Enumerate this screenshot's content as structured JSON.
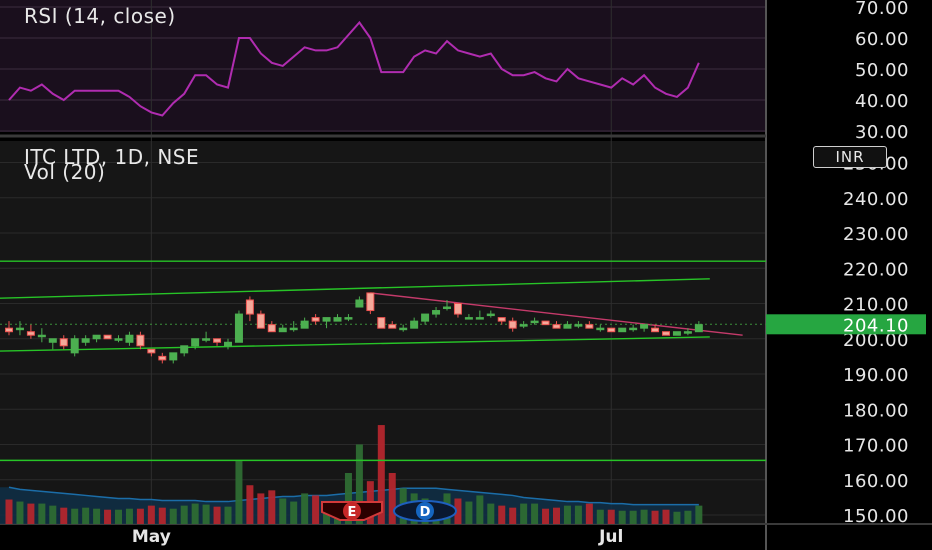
{
  "header": {
    "rsi_title": "RSI (14, close)",
    "instrument": "ITC LTD, 1D, NSE",
    "volume_label": "Vol (20)",
    "currency": "INR"
  },
  "colors": {
    "up": "#4caf50",
    "down": "#ef5350",
    "rsi_line": "#b02cb0",
    "trend_support": "#27c427",
    "trend_resistance": "#c43a6a",
    "price_badge": "#26a641",
    "volume_ma": "#1b6da8"
  },
  "event_markers": [
    "E",
    "D"
  ],
  "chart_data": [
    {
      "type": "line",
      "title": "RSI (14, close)",
      "ylim": [
        30,
        70
      ],
      "ticks": [
        "30.00",
        "40.00",
        "50.00",
        "60.00",
        "70.00"
      ],
      "x": [
        0,
        1,
        2,
        3,
        4,
        5,
        6,
        7,
        8,
        9,
        10,
        11,
        12,
        13,
        14,
        15,
        16,
        17,
        18,
        19,
        20,
        21,
        22,
        23,
        24,
        25,
        26,
        27,
        28,
        29,
        30,
        31,
        32,
        33,
        34,
        35,
        36,
        37,
        38,
        39,
        40,
        41,
        42,
        43,
        44,
        45,
        46,
        47,
        48,
        49,
        50,
        51,
        52,
        53,
        54,
        55,
        56,
        57,
        58,
        59,
        60,
        61,
        62,
        63
      ],
      "values": [
        40,
        44,
        43,
        45,
        42,
        40,
        43,
        43,
        43,
        43,
        43,
        41,
        38,
        36,
        35,
        39,
        42,
        48,
        48,
        45,
        44,
        60,
        60,
        55,
        52,
        51,
        54,
        57,
        56,
        56,
        57,
        61,
        65,
        60,
        49,
        49,
        49,
        54,
        56,
        55,
        59,
        56,
        55,
        54,
        55,
        50,
        48,
        48,
        49,
        47,
        46,
        50,
        47,
        46,
        45,
        44,
        47,
        45,
        48,
        44,
        42,
        41,
        44,
        52
      ]
    },
    {
      "type": "candlestick",
      "title": "ITC LTD, 1D, NSE",
      "ylim": [
        150,
        250
      ],
      "ticks": [
        "150.00",
        "160.00",
        "170.00",
        "180.00",
        "190.00",
        "200.00",
        "210.00",
        "220.00",
        "230.00",
        "240.00",
        "250.00"
      ],
      "x_labels": [
        {
          "label": "May",
          "index": 13
        },
        {
          "label": "Jul",
          "index": 55
        }
      ],
      "current_price": "204.10",
      "candles": [
        [
          203,
          205,
          201,
          202
        ],
        [
          203,
          205,
          201,
          203
        ],
        [
          202,
          204,
          200,
          201
        ],
        [
          201,
          203,
          199,
          201
        ],
        [
          199,
          200,
          197,
          200
        ],
        [
          200,
          201,
          197,
          198
        ],
        [
          196,
          201,
          195,
          200
        ],
        [
          199,
          201,
          198,
          200
        ],
        [
          200,
          201,
          199,
          201
        ],
        [
          201,
          201,
          200,
          200
        ],
        [
          200,
          201,
          199,
          200
        ],
        [
          199,
          202,
          198,
          201
        ],
        [
          201,
          202,
          197,
          198
        ],
        [
          197,
          197,
          195,
          196
        ],
        [
          195,
          196,
          193,
          194
        ],
        [
          194,
          196,
          193,
          196
        ],
        [
          196,
          198,
          195,
          198
        ],
        [
          198,
          200,
          197,
          200
        ],
        [
          200,
          202,
          199,
          200
        ],
        [
          200,
          200,
          198,
          199
        ],
        [
          198,
          200,
          197,
          199
        ],
        [
          199,
          208,
          199,
          207
        ],
        [
          211,
          212,
          205,
          207
        ],
        [
          207,
          208,
          203,
          203
        ],
        [
          204,
          205,
          202,
          202
        ],
        [
          202,
          204,
          202,
          203
        ],
        [
          203,
          205,
          202,
          203
        ],
        [
          203,
          206,
          203,
          205
        ],
        [
          206,
          207,
          204,
          205
        ],
        [
          205,
          206,
          203,
          206
        ],
        [
          205,
          207,
          205,
          206
        ],
        [
          206,
          207,
          205,
          206
        ],
        [
          209,
          212,
          209,
          211
        ],
        [
          213,
          213,
          207,
          208
        ],
        [
          206,
          206,
          203,
          203
        ],
        [
          204,
          205,
          203,
          203
        ],
        [
          203,
          204,
          202,
          203
        ],
        [
          203,
          206,
          203,
          205
        ],
        [
          205,
          207,
          204,
          207
        ],
        [
          207,
          209,
          206,
          208
        ],
        [
          209,
          211,
          208,
          209
        ],
        [
          210,
          210,
          206,
          207
        ],
        [
          206,
          207,
          206,
          206
        ],
        [
          206,
          208,
          206,
          206
        ],
        [
          207,
          208,
          206,
          207
        ],
        [
          206,
          206,
          204,
          205
        ],
        [
          205,
          206,
          202,
          203
        ],
        [
          204,
          205,
          203,
          204
        ],
        [
          205,
          206,
          204,
          205
        ],
        [
          205,
          205,
          204,
          204
        ],
        [
          204,
          205,
          203,
          203
        ],
        [
          203,
          205,
          203,
          204
        ],
        [
          204,
          205,
          203,
          204
        ],
        [
          204,
          205,
          203,
          203
        ],
        [
          203,
          204,
          202,
          203
        ],
        [
          203,
          203,
          202,
          202
        ],
        [
          202,
          203,
          202,
          203
        ],
        [
          203,
          204,
          202,
          203
        ],
        [
          203,
          204,
          202,
          204
        ],
        [
          203,
          204,
          202,
          202
        ],
        [
          202,
          202,
          201,
          201
        ],
        [
          201,
          202,
          201,
          202
        ],
        [
          202,
          203,
          201,
          202
        ],
        [
          202,
          205,
          202,
          204
        ]
      ],
      "volume": [
        0.24,
        0.22,
        0.2,
        0.2,
        0.18,
        0.16,
        0.15,
        0.16,
        0.15,
        0.14,
        0.14,
        0.15,
        0.15,
        0.18,
        0.16,
        0.15,
        0.18,
        0.2,
        0.19,
        0.17,
        0.17,
        0.62,
        0.38,
        0.3,
        0.33,
        0.25,
        0.22,
        0.3,
        0.28,
        0.18,
        0.2,
        0.5,
        0.78,
        0.42,
        0.97,
        0.5,
        0.35,
        0.3,
        0.25,
        0.22,
        0.3,
        0.25,
        0.22,
        0.28,
        0.2,
        0.18,
        0.16,
        0.2,
        0.2,
        0.15,
        0.16,
        0.18,
        0.18,
        0.2,
        0.14,
        0.14,
        0.13,
        0.13,
        0.14,
        0.13,
        0.14,
        0.12,
        0.13,
        0.18
      ],
      "volume_ma": [
        0.36,
        0.34,
        0.33,
        0.32,
        0.31,
        0.3,
        0.29,
        0.28,
        0.27,
        0.26,
        0.25,
        0.25,
        0.24,
        0.24,
        0.23,
        0.23,
        0.23,
        0.23,
        0.22,
        0.22,
        0.22,
        0.23,
        0.24,
        0.25,
        0.26,
        0.27,
        0.27,
        0.28,
        0.28,
        0.28,
        0.29,
        0.3,
        0.31,
        0.32,
        0.33,
        0.34,
        0.35,
        0.35,
        0.35,
        0.35,
        0.34,
        0.33,
        0.32,
        0.31,
        0.3,
        0.29,
        0.28,
        0.26,
        0.25,
        0.24,
        0.23,
        0.22,
        0.22,
        0.21,
        0.21,
        0.2,
        0.2,
        0.19,
        0.19,
        0.19,
        0.19,
        0.19,
        0.19,
        0.19
      ],
      "horizontal_lines": [
        222,
        165.5
      ],
      "trend_lines": [
        {
          "role": "support",
          "from": [
            -1,
            196.5
          ],
          "to": [
            64,
            200.5
          ]
        },
        {
          "role": "upper",
          "from": [
            -1,
            211.5
          ],
          "to": [
            64,
            217
          ]
        },
        {
          "role": "resistance",
          "from": [
            33,
            213
          ],
          "to": [
            67,
            201
          ]
        }
      ],
      "reference_line": 204.1
    }
  ]
}
